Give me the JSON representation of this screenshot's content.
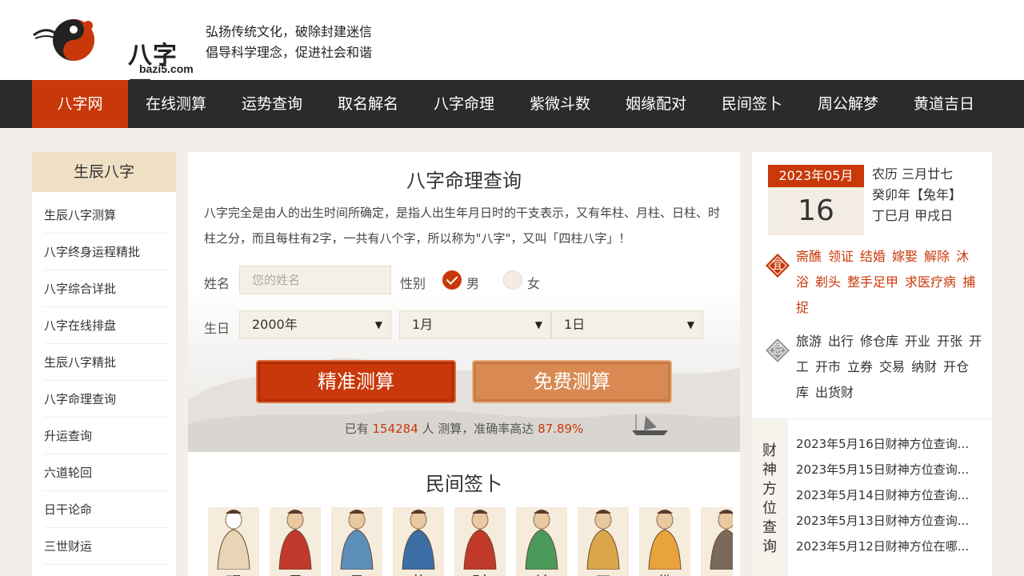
{
  "header": {
    "logo_text": "八字网",
    "logo_domain": "bazi5.com",
    "slogan_line1": "弘扬传统文化，破除封建迷信",
    "slogan_line2": "倡导科学理念，促进社会和谐"
  },
  "nav": {
    "items": [
      {
        "label": "八字网",
        "active": true
      },
      {
        "label": "在线测算"
      },
      {
        "label": "运势查询"
      },
      {
        "label": "取名解名"
      },
      {
        "label": "八字命理"
      },
      {
        "label": "紫微斗数"
      },
      {
        "label": "姻缘配对"
      },
      {
        "label": "民间签卜"
      },
      {
        "label": "周公解梦"
      },
      {
        "label": "黄道吉日"
      }
    ]
  },
  "sidebar": {
    "title": "生辰八字",
    "items": [
      {
        "label": "生辰八字测算"
      },
      {
        "label": "八字终身运程精批"
      },
      {
        "label": "八字综合详批"
      },
      {
        "label": "八字在线排盘"
      },
      {
        "label": "生辰八字精批"
      },
      {
        "label": "八字命理查询"
      },
      {
        "label": "升运查询"
      },
      {
        "label": "六道轮回"
      },
      {
        "label": "日干论命"
      },
      {
        "label": "三世财运"
      }
    ]
  },
  "form": {
    "title": "八字命理查询",
    "description": "八字完全是由人的出生时间所确定，是指人出生年月日时的干支表示，又有年柱、月柱、日柱、时柱之分，而且每柱有2字，一共有八个字，所以称为\"八字\"，又叫「四柱八字」！",
    "name_label": "姓名",
    "name_placeholder": "您的姓名",
    "gender_label": "性别",
    "gender_male": "男",
    "gender_female": "女",
    "birth_label": "生日",
    "year": "2000年",
    "month": "1月",
    "day": "1日",
    "btn_precise": "精准测算",
    "btn_free": "免费测算",
    "stats_prefix": "已有",
    "stats_count": "154284",
    "stats_mid": "人 测算，准确率高达",
    "stats_rate": "87.89%"
  },
  "folk": {
    "title": "民间签卜",
    "deities": [
      {
        "name": "观",
        "color": "#ffffff",
        "robe": "#e8d5b5"
      },
      {
        "name": "月",
        "color": "#e8c9a0",
        "robe": "#c0392b"
      },
      {
        "name": "吕",
        "color": "#e8c9a0",
        "robe": "#5b8fb9"
      },
      {
        "name": "黄",
        "color": "#e8c9a0",
        "robe": "#3a6ea5"
      },
      {
        "name": "财",
        "color": "#e8c9a0",
        "robe": "#c0392b"
      },
      {
        "name": "关",
        "color": "#e8c9a0",
        "robe": "#4a9a5a"
      },
      {
        "name": "天",
        "color": "#e8c9a0",
        "robe": "#d9a74a"
      },
      {
        "name": "佛",
        "color": "#e8c9a0",
        "robe": "#e8a33a"
      },
      {
        "name": "",
        "color": "#e8c9a0",
        "robe": "#7a6a5a"
      }
    ]
  },
  "calendar": {
    "month": "2023年05月",
    "day": "16",
    "lunar": "农历 三月廿七",
    "year_gz": "癸卯年【兔年】",
    "month_day_gz": "丁巳月 甲戌日",
    "yi_label": "宜",
    "yi": [
      "斋醮",
      "领证",
      "结婚",
      "嫁娶",
      "解除",
      "沐浴",
      "剃头",
      "整手足甲",
      "求医疗病",
      "捕捉"
    ],
    "ji_label": "忌",
    "ji": [
      "旅游",
      "出行",
      "修仓库",
      "开业",
      "开张",
      "开工",
      "开市",
      "立券",
      "交易",
      "纳财",
      "开仓库",
      "出货财"
    ]
  },
  "caishen": {
    "label": "财神方位查询",
    "items": [
      "2023年5月16日财神方位查询...",
      "2023年5月15日财神方位查询...",
      "2023年5月14日财神方位查询...",
      "2023年5月13日财神方位查询...",
      "2023年5月12日财神方位在哪..."
    ]
  },
  "colors": {
    "accent": "#c9380a",
    "nav_bg": "#2b2b2b",
    "free_btn": "#d98a52",
    "sidebar_head": "#efdfc4"
  }
}
